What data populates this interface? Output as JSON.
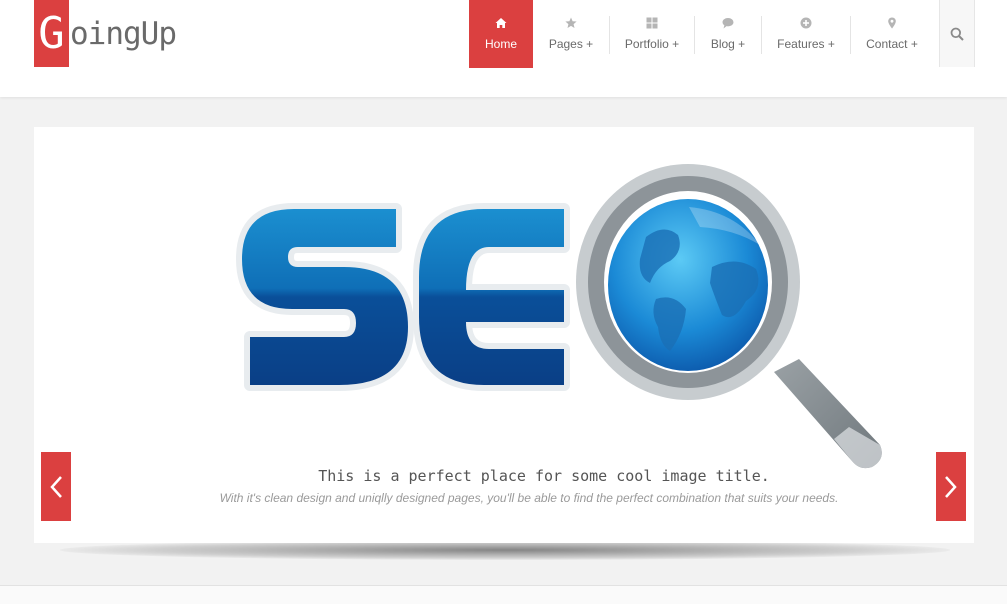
{
  "brand": {
    "logo_initial": "G",
    "logo_rest": "oingUp",
    "accent_color": "#db4040"
  },
  "nav": {
    "items": [
      {
        "label": "Home",
        "icon": "home-icon",
        "active": true
      },
      {
        "label": "Pages +",
        "icon": "star-icon",
        "active": false
      },
      {
        "label": "Portfolio +",
        "icon": "grid-icon",
        "active": false
      },
      {
        "label": "Blog +",
        "icon": "chat-icon",
        "active": false
      },
      {
        "label": "Features +",
        "icon": "plus-circle-icon",
        "active": false
      },
      {
        "label": "Contact +",
        "icon": "map-pin-icon",
        "active": false
      }
    ],
    "search_icon": "search-icon"
  },
  "slider": {
    "image_text": "SEQ",
    "caption_title": "This is a perfect place for some cool image title.",
    "caption_subtitle": "With it's clean design and uniqlly designed pages, you'll be able to find the perfect combination that suits your needs.",
    "prev_icon": "chevron-left-icon",
    "next_icon": "chevron-right-icon"
  }
}
